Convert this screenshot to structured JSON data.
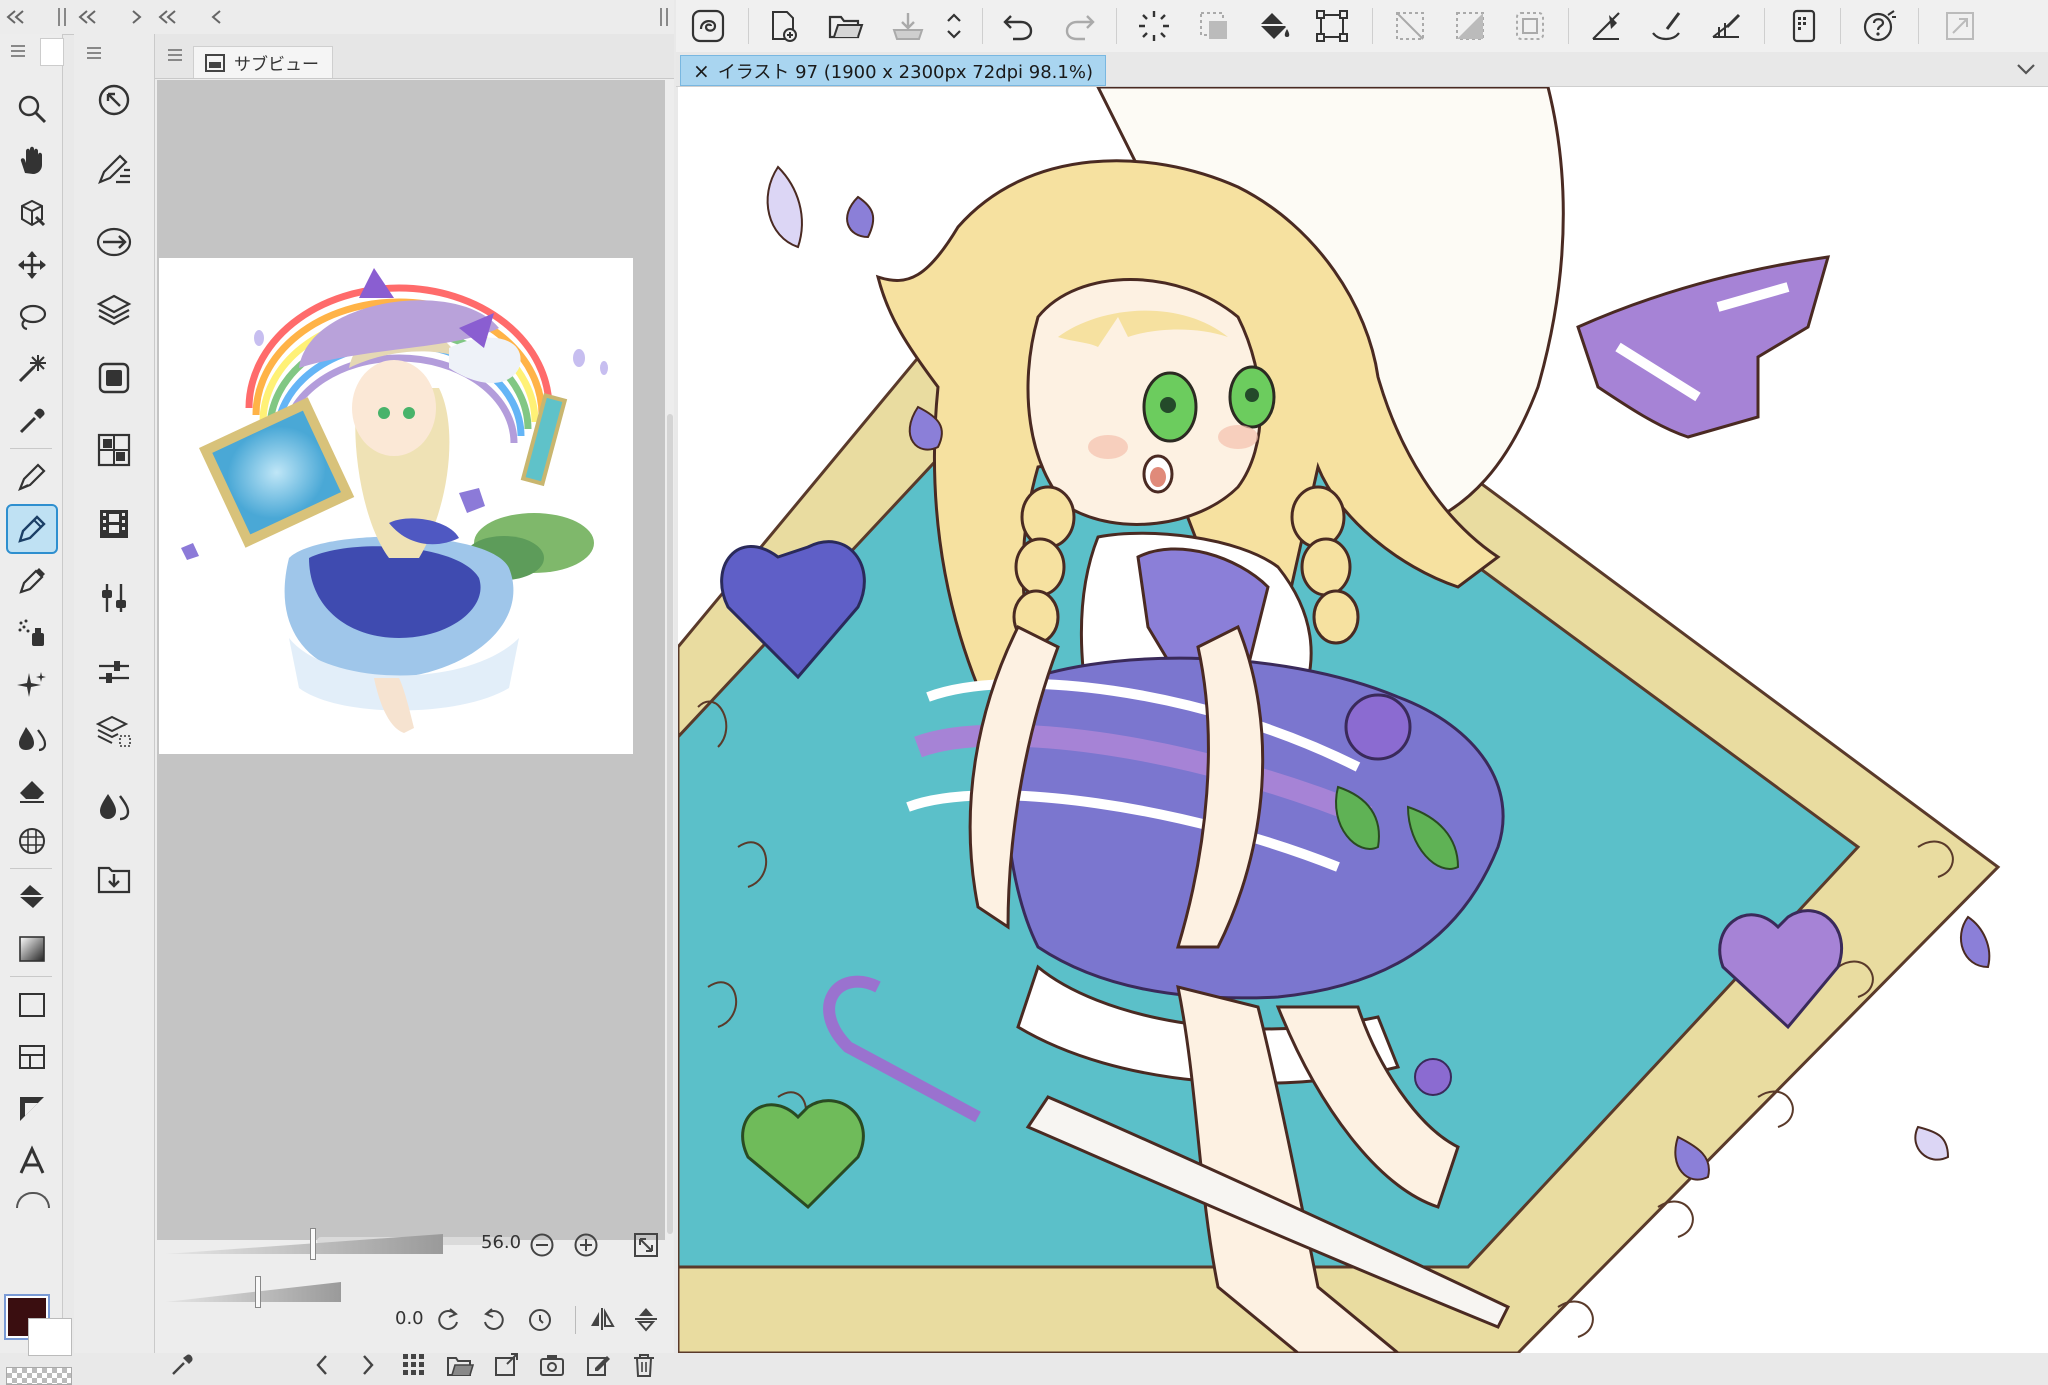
{
  "subview": {
    "tab_label": "サブビュー",
    "zoom_value": "56.0",
    "rotate_value": "0.0"
  },
  "document": {
    "tab_title": "イラスト 97 (1900 x 2300px 72dpi 98.1%)",
    "close_glyph": "×"
  },
  "colors": {
    "foreground": "#3a0e10",
    "background": "#ffffff",
    "accent": "#2e8fcf",
    "tab_highlight": "#a9d5f0"
  },
  "icons": {
    "command_bar": [
      "clip-studio-icon",
      "new-file-icon",
      "open-folder-icon",
      "save-icon",
      "up-down-arrows-icon",
      "undo-icon",
      "redo-icon",
      "deselect-dots-icon",
      "clear-selection-icon",
      "fill-icon",
      "transform-icon",
      "invert-selection-icon",
      "gradient-selection-icon",
      "select-layer-icon",
      "ruler-icon",
      "brush-ruler-icon",
      "perspective-ruler-icon",
      "device-icon",
      "help-icon",
      "expand-icon"
    ],
    "tools": [
      "zoom-icon",
      "hand-icon",
      "cube-icon",
      "move-icon",
      "lasso-icon",
      "magic-wand-icon",
      "eyedropper-icon",
      "pen-icon",
      "pencil-icon",
      "marker-icon",
      "airbrush-icon",
      "sparkle-icon",
      "blend-icon",
      "eraser-icon",
      "mesh-icon",
      "bucket-icon",
      "gradient-icon",
      "rectangle-icon",
      "frame-icon",
      "ruler-tool-icon",
      "text-icon"
    ],
    "palettes": [
      "navigator-icon",
      "brush-palette-icon",
      "transfer-icon",
      "layers-icon",
      "material-icon",
      "grid-palette-icon",
      "film-icon",
      "adjust-icon",
      "slider-icon",
      "layer-search-icon",
      "droplet-icon",
      "download-icon"
    ]
  }
}
